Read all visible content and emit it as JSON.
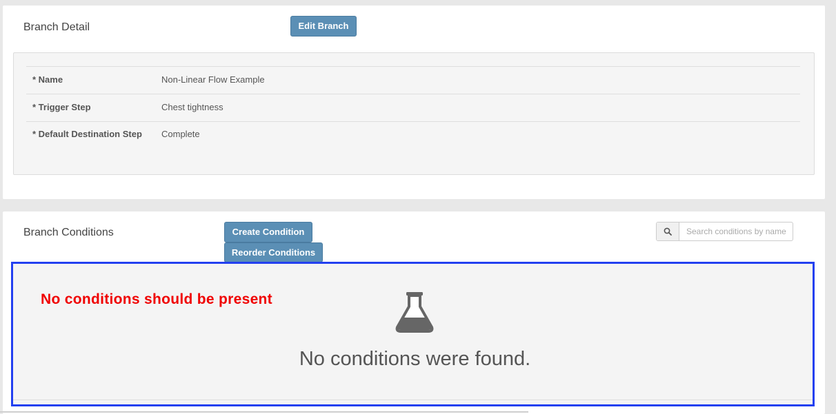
{
  "branch_detail": {
    "title": "Branch Detail",
    "edit_button_label": "Edit Branch",
    "fields": [
      {
        "label": "* Name",
        "value": "Non-Linear Flow Example"
      },
      {
        "label": "* Trigger Step",
        "value": "Chest tightness"
      },
      {
        "label": "* Default Destination Step",
        "value": "Complete"
      }
    ]
  },
  "branch_conditions": {
    "title": "Branch Conditions",
    "create_button_label": "Create Condition",
    "reorder_button_label": "Reorder Conditions",
    "search": {
      "placeholder": "Search conditions by name",
      "value": "",
      "icon": "search-icon"
    },
    "empty_state": {
      "icon": "flask-icon",
      "message": "No conditions were found."
    }
  },
  "annotation": {
    "text": "No conditions should be present",
    "color": "#f00000",
    "highlight_color": "#2340f0"
  },
  "colors": {
    "button_bg": "#5b8fb5",
    "page_bg": "#e8e8e8"
  }
}
